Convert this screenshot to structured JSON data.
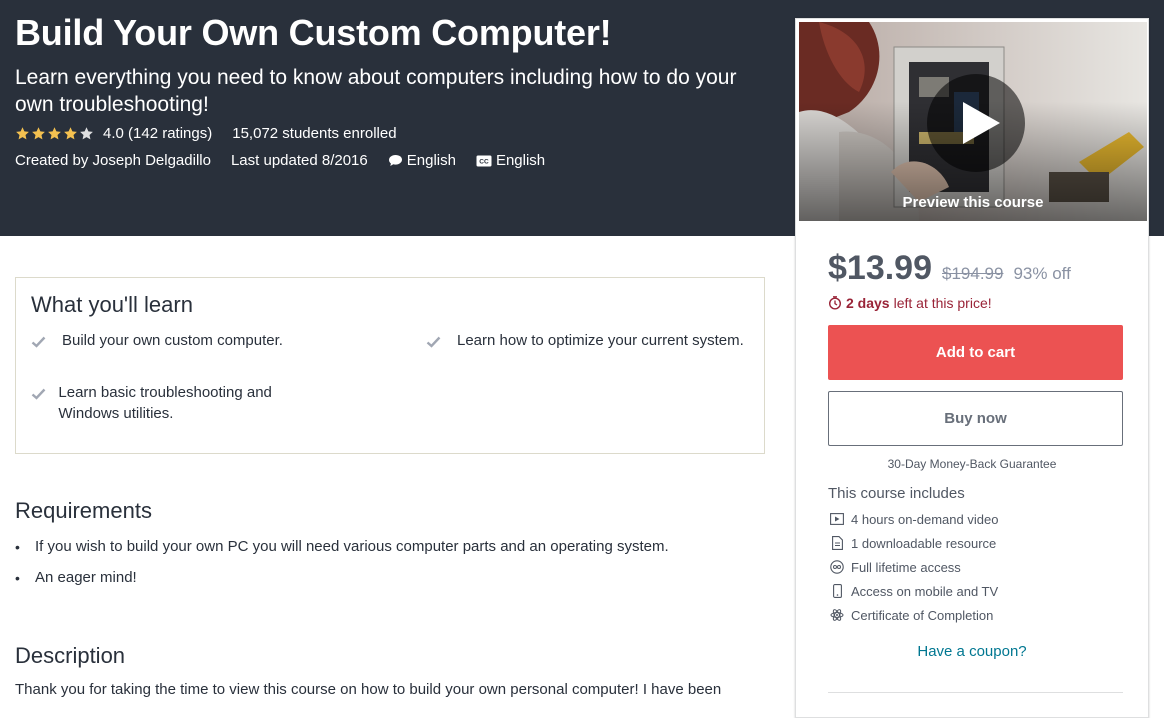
{
  "course": {
    "title": "Build Your Own Custom Computer!",
    "subtitle": "Learn everything you need to know about computers including how to do your own troubleshooting!",
    "rating_value": "4.0",
    "stars": 4,
    "ratings_text": "(142 ratings)",
    "students_text": "15,072 students enrolled",
    "created_by": "Created by Joseph Delgadillo",
    "last_updated": "Last updated 8/2016",
    "language": "English",
    "captions": "English"
  },
  "sidebar": {
    "preview_label": "Preview this course",
    "price": "$13.99",
    "original_price": "$194.99",
    "discount": "93% off",
    "timer_bold": "2 days",
    "timer_rest": "left at this price!",
    "add_to_cart": "Add to cart",
    "buy_now": "Buy now",
    "guarantee": "30-Day Money-Back Guarantee",
    "includes_title": "This course includes",
    "includes": [
      {
        "icon": "video-icon",
        "label": "4 hours on-demand video"
      },
      {
        "icon": "file-icon",
        "label": "1 downloadable resource"
      },
      {
        "icon": "infinity-icon",
        "label": "Full lifetime access"
      },
      {
        "icon": "mobile-icon",
        "label": "Access on mobile and TV"
      },
      {
        "icon": "certificate-icon",
        "label": "Certificate of Completion"
      }
    ],
    "coupon": "Have a coupon?"
  },
  "learn": {
    "title": "What you'll learn",
    "items": [
      "Build your own custom computer.",
      "Learn how to optimize your current system.",
      "Learn basic troubleshooting and Windows utilities."
    ]
  },
  "requirements": {
    "title": "Requirements",
    "items": [
      "If you wish to build your own PC you will need various computer parts and an operating system.",
      "An eager mind!"
    ]
  },
  "description": {
    "title": "Description",
    "text": "Thank you for taking the time to view this course on how to build your own personal computer! I have been"
  },
  "colors": {
    "hero_bg": "#29303b",
    "cart_button": "#ec5252",
    "star": "#f4c150",
    "timer": "#992337",
    "link": "#007791"
  }
}
